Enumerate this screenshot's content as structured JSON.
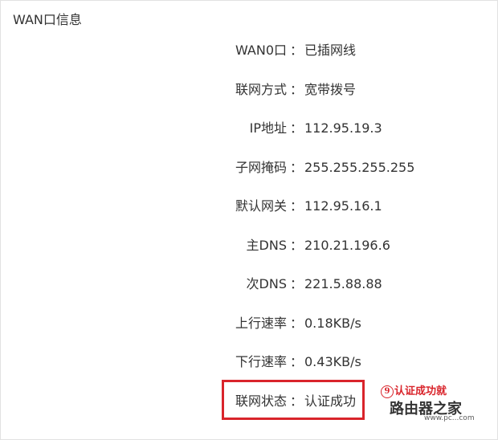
{
  "panel": {
    "title": "WAN口信息"
  },
  "rows": [
    {
      "label": "WAN0口",
      "value": "已插网线"
    },
    {
      "label": "联网方式",
      "value": "宽带拨号"
    },
    {
      "label": "IP地址",
      "value": "112.95.19.3"
    },
    {
      "label": "子网掩码",
      "value": "255.255.255.255"
    },
    {
      "label": "默认网关",
      "value": "112.95.16.1"
    },
    {
      "label": "主DNS",
      "value": "210.21.196.6"
    },
    {
      "label": "次DNS",
      "value": "221.5.88.88"
    },
    {
      "label": "上行速率",
      "value": "0.18KB/s"
    },
    {
      "label": "下行速率",
      "value": "0.43KB/s"
    },
    {
      "label": "联网状态",
      "value": "认证成功"
    }
  ],
  "separator": "：",
  "annotation": {
    "number": "9",
    "text": "认证成功就",
    "color": "#d9242b"
  },
  "watermark": {
    "text": "路由器之家",
    "url": "www.pc...com"
  }
}
